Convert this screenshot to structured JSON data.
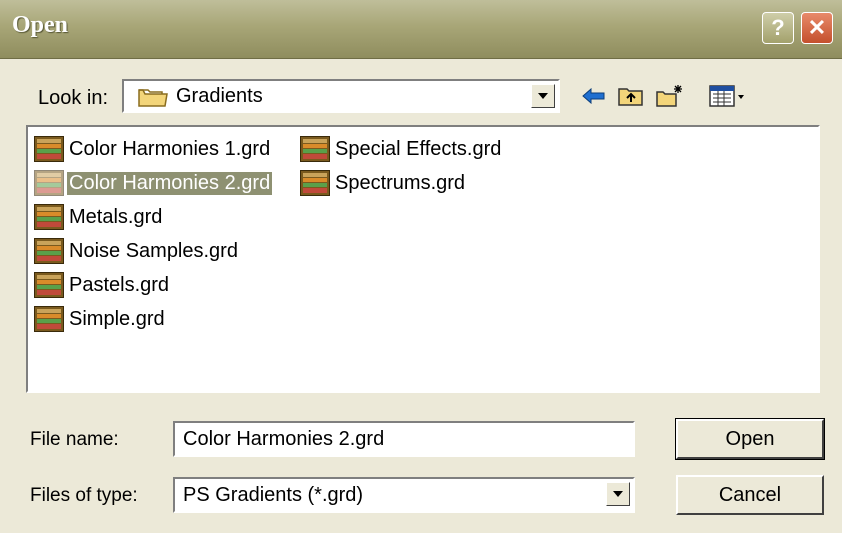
{
  "window": {
    "title": "Open"
  },
  "title_buttons": {
    "help": "?",
    "close": "✕"
  },
  "look_in": {
    "label": "Look in:",
    "value": "Gradients"
  },
  "toolbar": [
    "back-icon",
    "up-folder-icon",
    "new-folder-icon",
    "view-menu-icon"
  ],
  "files": [
    {
      "name": "Color Harmonies 1.grd",
      "selected": false
    },
    {
      "name": "Color Harmonies 2.grd",
      "selected": true
    },
    {
      "name": "Metals.grd",
      "selected": false
    },
    {
      "name": "Noise Samples.grd",
      "selected": false
    },
    {
      "name": "Pastels.grd",
      "selected": false
    },
    {
      "name": "Simple.grd",
      "selected": false
    },
    {
      "name": "Special Effects.grd",
      "selected": false
    },
    {
      "name": "Spectrums.grd",
      "selected": false
    }
  ],
  "file_name": {
    "label": "File name:",
    "value": "Color Harmonies 2.grd"
  },
  "file_type": {
    "label": "Files of type:",
    "value": "PS Gradients (*.grd)"
  },
  "buttons": {
    "open": "Open",
    "cancel": "Cancel"
  },
  "colors": {
    "selection": "#8e9172",
    "titlebar": "#a8a677",
    "close": "#c4502d"
  }
}
